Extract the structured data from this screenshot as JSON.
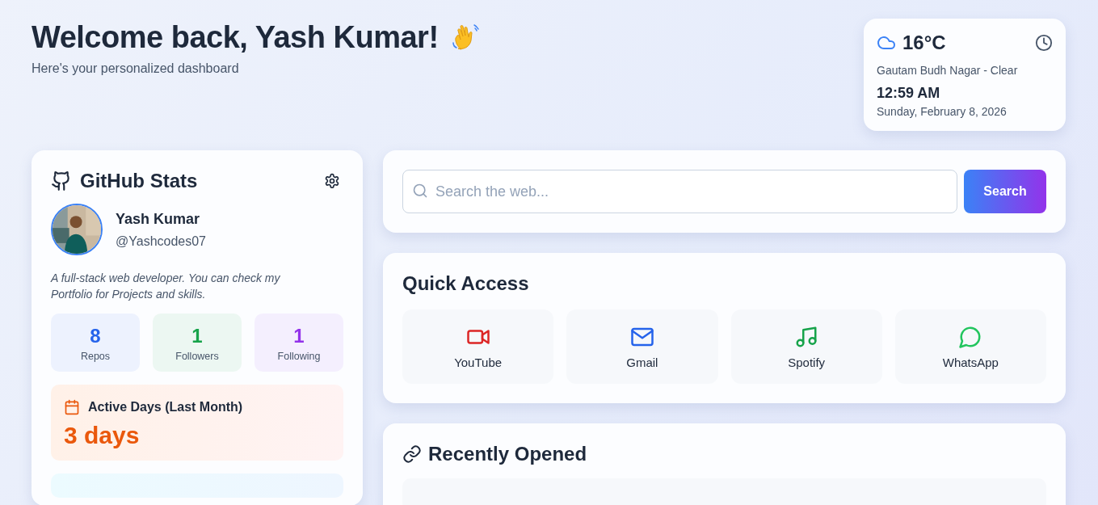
{
  "header": {
    "title": "Welcome back, Yash Kumar!",
    "subtitle": "Here's your personalized dashboard"
  },
  "weather": {
    "temperature": "16°C",
    "location": "Gautam Budh Nagar - Clear",
    "time": "12:59 AM",
    "date": "Sunday, February 8, 2026"
  },
  "github": {
    "title": "GitHub Stats",
    "name": "Yash Kumar",
    "username": "@Yashcodes07",
    "bio": "A full-stack web developer. You can check my Portfolio for Projects and skills.",
    "stats": [
      {
        "value": "8",
        "label": "Repos",
        "color": "#2563eb"
      },
      {
        "value": "1",
        "label": "Followers",
        "color": "#16a34a"
      },
      {
        "value": "1",
        "label": "Following",
        "color": "#9333ea"
      }
    ],
    "active_days": {
      "label": "Active Days (Last Month)",
      "value": "3 days"
    }
  },
  "search": {
    "placeholder": "Search the web...",
    "button": "Search"
  },
  "quick_access": {
    "title": "Quick Access",
    "items": [
      {
        "kind": "video",
        "label": "YouTube",
        "color": "#dc2626"
      },
      {
        "kind": "mail",
        "label": "Gmail",
        "color": "#2563eb"
      },
      {
        "kind": "music",
        "label": "Spotify",
        "color": "#16a34a"
      },
      {
        "kind": "chat",
        "label": "WhatsApp",
        "color": "#22c55e"
      }
    ]
  },
  "recently_opened": {
    "title": "Recently Opened"
  }
}
